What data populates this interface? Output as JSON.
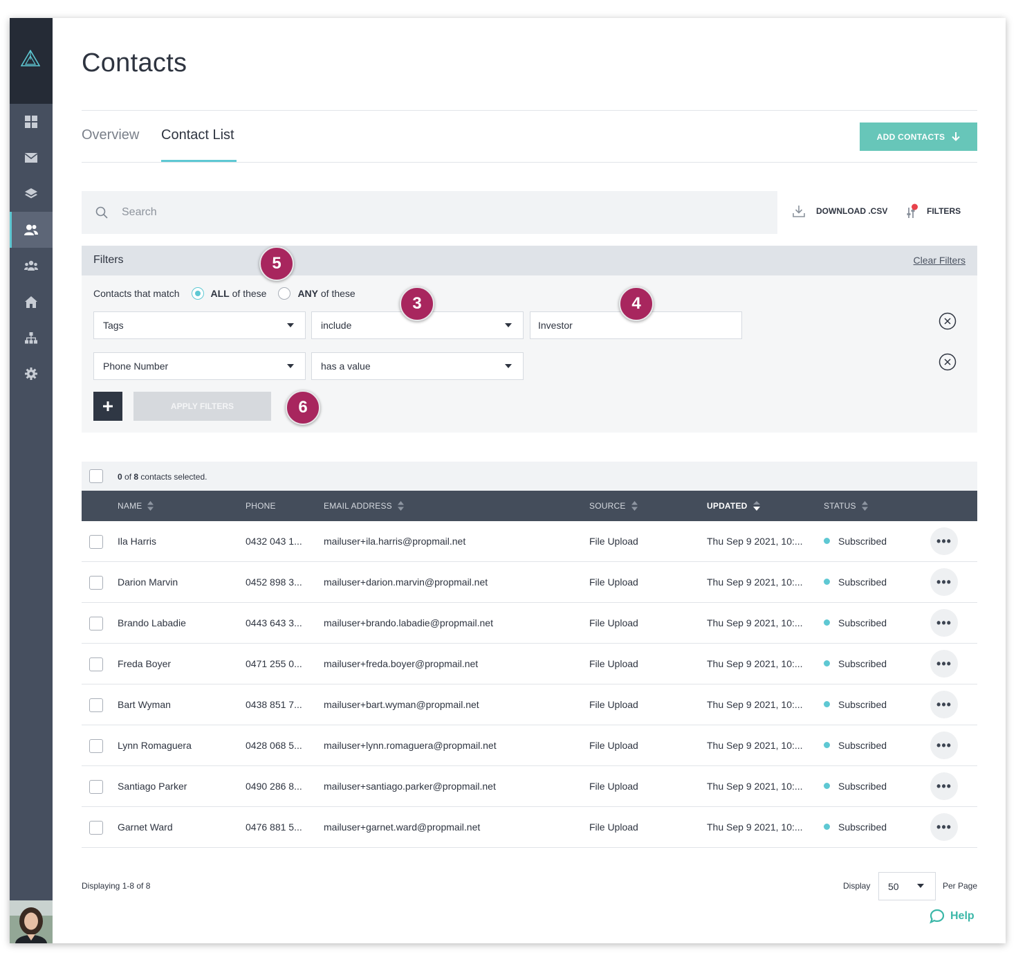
{
  "page": {
    "title": "Contacts"
  },
  "tabs": [
    {
      "label": "Overview"
    },
    {
      "label": "Contact List"
    }
  ],
  "actions": {
    "add_contacts": "ADD CONTACTS",
    "download_csv": "DOWNLOAD .CSV",
    "filters": "FILTERS"
  },
  "search": {
    "placeholder": "Search",
    "value": ""
  },
  "filters": {
    "title": "Filters",
    "clear": "Clear Filters",
    "match_prefix": "Contacts that match",
    "all_bold": "ALL",
    "all_rest": " of these",
    "any_bold": "ANY",
    "any_rest": " of these",
    "rows": [
      {
        "field": "Tags",
        "operator": "include",
        "value": "Investor"
      },
      {
        "field": "Phone Number",
        "operator": "has a value"
      }
    ],
    "apply": "APPLY FILTERS"
  },
  "badges": [
    "5",
    "3",
    "4",
    "6"
  ],
  "selection": {
    "count": "0",
    "of": " of ",
    "total": "8",
    "suffix": " contacts selected."
  },
  "columns": {
    "name": "NAME",
    "phone": "PHONE",
    "email": "EMAIL ADDRESS",
    "source": "SOURCE",
    "updated": "UPDATED",
    "status": "STATUS"
  },
  "contacts": [
    {
      "name": "Ila Harris",
      "phone": "0432 043 1...",
      "email": "mailuser+ila.harris@propmail.net",
      "source": "File Upload",
      "updated": "Thu Sep 9 2021, 10:...",
      "status": "Subscribed"
    },
    {
      "name": "Darion Marvin",
      "phone": "0452 898 3...",
      "email": "mailuser+darion.marvin@propmail.net",
      "source": "File Upload",
      "updated": "Thu Sep 9 2021, 10:...",
      "status": "Subscribed"
    },
    {
      "name": "Brando Labadie",
      "phone": "0443 643 3...",
      "email": "mailuser+brando.labadie@propmail.net",
      "source": "File Upload",
      "updated": "Thu Sep 9 2021, 10:...",
      "status": "Subscribed"
    },
    {
      "name": "Freda Boyer",
      "phone": "0471 255 0...",
      "email": "mailuser+freda.boyer@propmail.net",
      "source": "File Upload",
      "updated": "Thu Sep 9 2021, 10:...",
      "status": "Subscribed"
    },
    {
      "name": "Bart Wyman",
      "phone": "0438 851 7...",
      "email": "mailuser+bart.wyman@propmail.net",
      "source": "File Upload",
      "updated": "Thu Sep 9 2021, 10:...",
      "status": "Subscribed"
    },
    {
      "name": "Lynn Romaguera",
      "phone": "0428 068 5...",
      "email": "mailuser+lynn.romaguera@propmail.net",
      "source": "File Upload",
      "updated": "Thu Sep 9 2021, 10:...",
      "status": "Subscribed"
    },
    {
      "name": "Santiago Parker",
      "phone": "0490 286 8...",
      "email": "mailuser+santiago.parker@propmail.net",
      "source": "File Upload",
      "updated": "Thu Sep 9 2021, 10:...",
      "status": "Subscribed"
    },
    {
      "name": "Garnet Ward",
      "phone": "0476 881 5...",
      "email": "mailuser+garnet.ward@propmail.net",
      "source": "File Upload",
      "updated": "Thu Sep 9 2021, 10:...",
      "status": "Subscribed"
    }
  ],
  "footer": {
    "displaying": "Displaying 1-8 of 8",
    "display_label": "Display",
    "per_page_value": "50",
    "per_page_label": "Per Page",
    "help": "Help"
  },
  "sidebar_icons": [
    "logo-icon",
    "dashboard-icon",
    "mail-icon",
    "layers-icon",
    "contacts-icon",
    "groups-icon",
    "home-icon",
    "sitemap-icon",
    "settings-icon"
  ],
  "colors": {
    "accent": "#5ec8d3",
    "add_button": "#67c6b9",
    "badge": "#a8265e",
    "sidebar": "#464f5f",
    "table_header": "#444d5b"
  }
}
